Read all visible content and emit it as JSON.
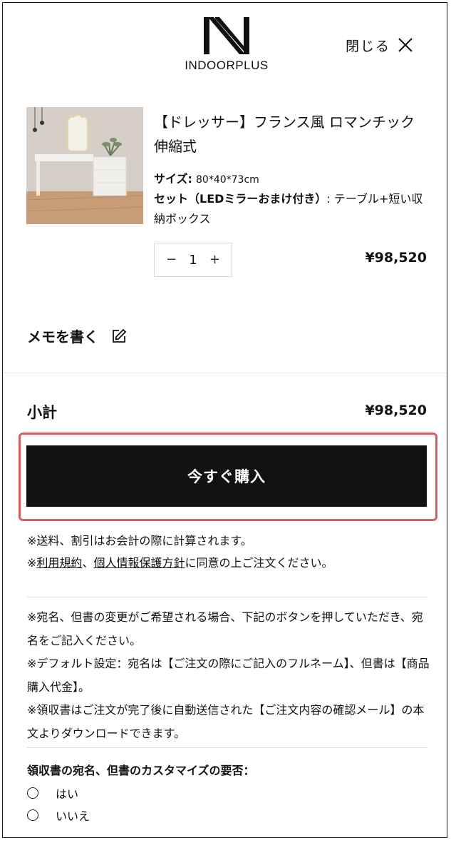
{
  "header": {
    "brand_name": "INDOORPLUS",
    "close_label": "閉じる"
  },
  "product": {
    "title": "【ドレッサー】フランス風 ロマンチック 伸縮式",
    "size_key": "サイズ:",
    "size_value": "80*40*73cm",
    "set_key": "セット（LEDミラーおまけ付き）",
    "set_value": ": テーブル+短い収納ボックス",
    "quantity": "1",
    "qty_minus": "−",
    "qty_plus": "+",
    "price": "¥98,520"
  },
  "memo": {
    "label": "メモを書く"
  },
  "summary": {
    "subtotal_label": "小計",
    "subtotal_value": "¥98,520",
    "buy_button_label": "今すぐ購入"
  },
  "notes": {
    "shipping_note": "※送料、割引はお会計の際に計算されます。",
    "agree_prefix": "※",
    "terms_link": "利用規約",
    "separator": "、",
    "privacy_link": "個人情報保護方針",
    "agree_suffix": "に同意の上ご注文ください。",
    "receipt_note_1": "※宛名、但書の変更がご希望される場合、下記のボタンを押していただき、宛名をご記入ください。",
    "receipt_note_2": "※デフォルト設定：宛名は【ご注文の際にご記入のフルネーム】、但書は【商品購入代金】。",
    "receipt_note_3": "※領収書はご注文が完了後に自動送信された【ご注文内容の確認メール】の本文よりダウンロードできます。"
  },
  "receipt_option": {
    "heading": "領収書の宛名、但書のカスタマイズの要否：",
    "options": [
      "はい",
      "いいえ"
    ]
  },
  "colors": {
    "button_bg": "#121212",
    "highlight": "#d4605f",
    "text": "#111111",
    "divider": "#e3e3e3"
  }
}
